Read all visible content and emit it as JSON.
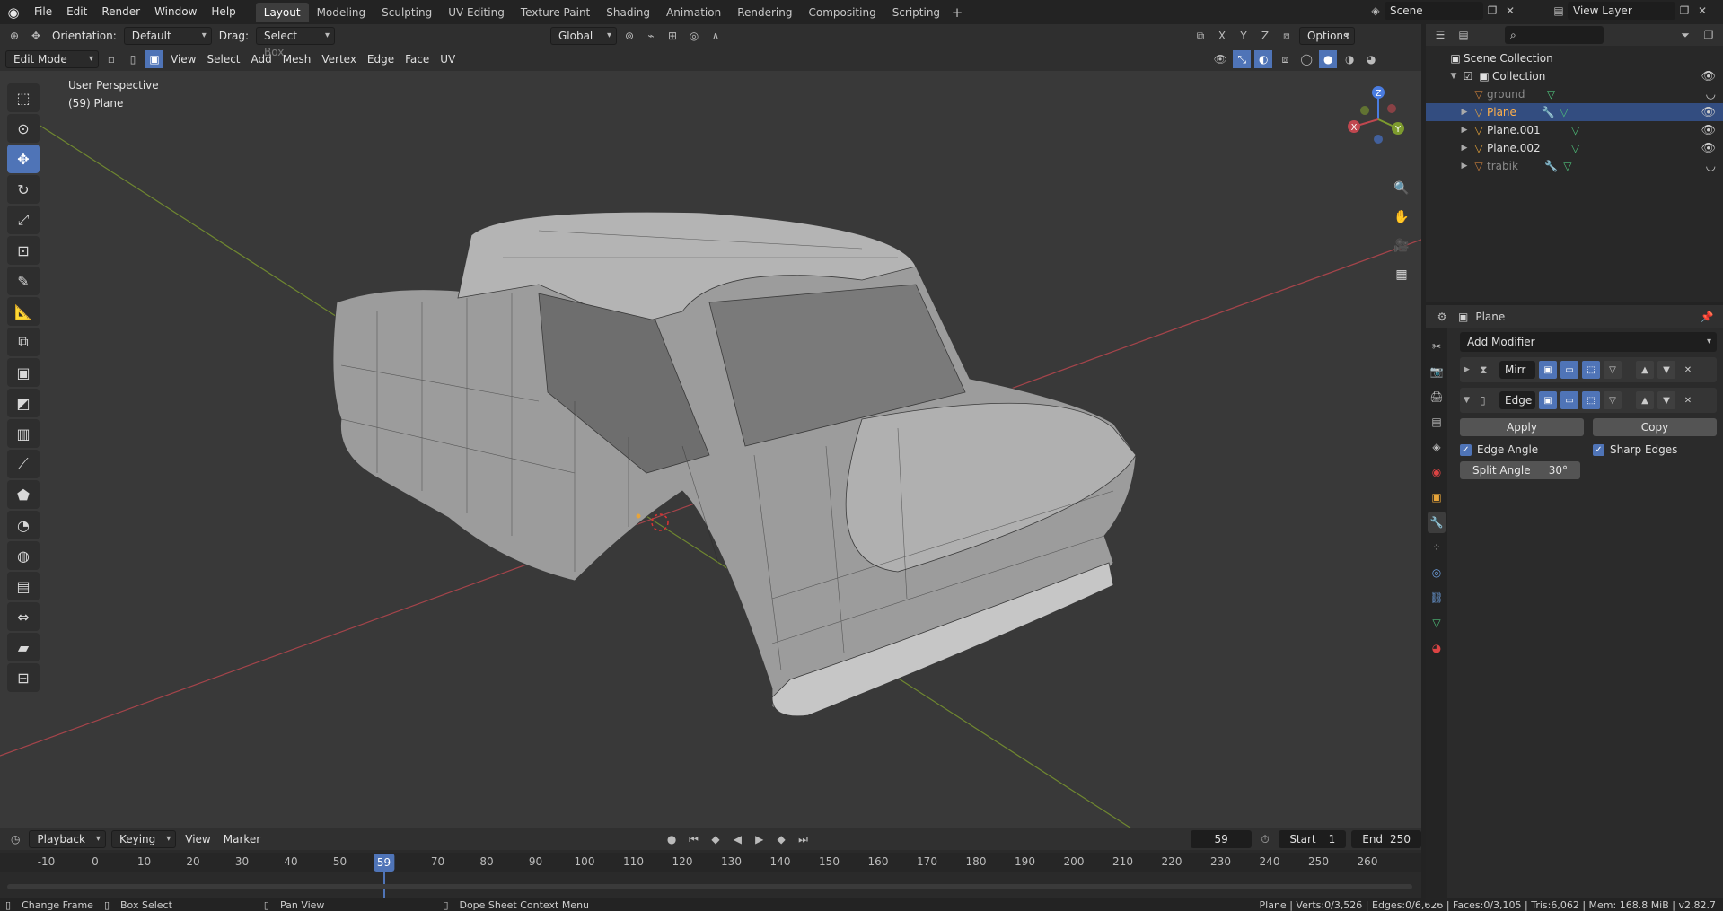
{
  "menu": {
    "file": "File",
    "edit": "Edit",
    "render": "Render",
    "window": "Window",
    "help": "Help"
  },
  "workspaces": [
    "Layout",
    "Modeling",
    "Sculpting",
    "UV Editing",
    "Texture Paint",
    "Shading",
    "Animation",
    "Rendering",
    "Compositing",
    "Scripting"
  ],
  "active_workspace": "Layout",
  "scene": {
    "name": "Scene",
    "view_layer": "View Layer"
  },
  "tool_header": {
    "orientation_label": "Orientation:",
    "orientation_value": "Default",
    "drag_label": "Drag:",
    "drag_value": "Select Box",
    "transform_orientation": "Global",
    "options": "Options",
    "axes": [
      "X",
      "Y",
      "Z"
    ]
  },
  "viewport_header": {
    "mode": "Edit Mode",
    "menus": [
      "View",
      "Select",
      "Add",
      "Mesh",
      "Vertex",
      "Edge",
      "Face",
      "UV"
    ]
  },
  "viewport": {
    "perspective": "User Perspective",
    "object_info": "(59) Plane"
  },
  "gizmo": {
    "x": "X",
    "y": "Y",
    "z": "Z"
  },
  "outliner": {
    "scene_collection": "Scene Collection",
    "collection": "Collection",
    "objects": [
      {
        "name": "ground",
        "dim": true
      },
      {
        "name": "Plane",
        "selected": true
      },
      {
        "name": "Plane.001"
      },
      {
        "name": "Plane.002"
      },
      {
        "name": "trabik",
        "dim": true
      }
    ]
  },
  "properties": {
    "object": "Plane",
    "add_modifier": "Add Modifier",
    "modifiers": [
      {
        "name": "Mirr"
      },
      {
        "name": "Edge"
      }
    ],
    "apply": "Apply",
    "copy": "Copy",
    "edge_angle": "Edge Angle",
    "sharp_edges": "Sharp Edges",
    "split_angle_label": "Split Angle",
    "split_angle_value": "30°"
  },
  "timeline": {
    "menus": [
      "Playback",
      "Keying",
      "View",
      "Marker"
    ],
    "current_frame": "59",
    "start_label": "Start",
    "start": "1",
    "end_label": "End",
    "end": "250",
    "ticks": [
      "-10",
      "0",
      "10",
      "20",
      "30",
      "40",
      "50",
      "70",
      "80",
      "90",
      "100",
      "110",
      "120",
      "130",
      "140",
      "150",
      "160",
      "170",
      "180",
      "190",
      "200",
      "210",
      "220",
      "230",
      "240",
      "250",
      "260"
    ],
    "cursor": "59"
  },
  "statusbar": {
    "change_frame": "Change Frame",
    "box_select": "Box Select",
    "pan_view": "Pan View",
    "context_menu": "Dope Sheet Context Menu",
    "stats": "Plane | Verts:0/3,526 | Edges:0/6,626 | Faces:0/3,105 | Tris:6,062 | Mem: 168.8 MiB | v2.82.7"
  },
  "colors": {
    "accent": "#4f74b7",
    "select_row": "#334d80",
    "x_axis": "#c0474f",
    "y_axis": "#7d9b2e",
    "z_axis": "#4a7ce0"
  }
}
